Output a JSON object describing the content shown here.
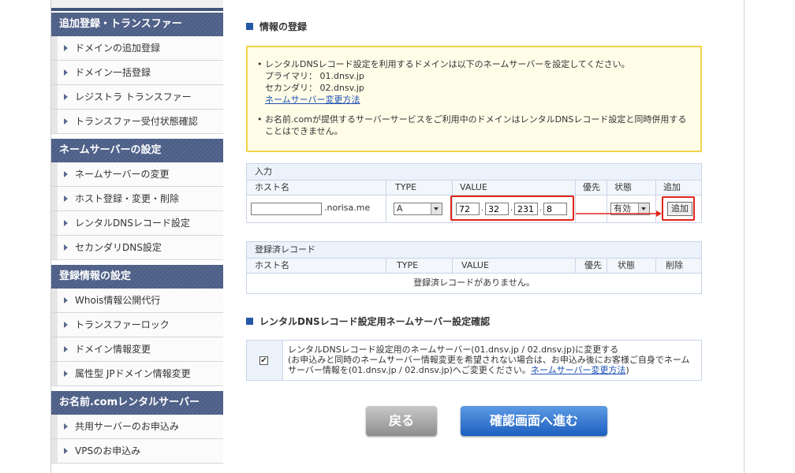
{
  "sidebar": {
    "sections": [
      {
        "title": "追加登録・トランスファー",
        "items": [
          "ドメインの追加登録",
          "ドメイン一括登録",
          "レジストラ トランスファー",
          "トランスファー受付状態確認"
        ]
      },
      {
        "title": "ネームサーバーの設定",
        "items": [
          "ネームサーバーの変更",
          "ホスト登録・変更・削除",
          "レンタルDNSレコード設定",
          "セカンダリDNS設定"
        ]
      },
      {
        "title": "登録情報の設定",
        "items": [
          "Whois情報公開代行",
          "トランスファーロック",
          "ドメイン情報変更",
          "属性型 JPドメイン情報変更"
        ]
      },
      {
        "title": "お名前.comレンタルサーバー",
        "items": [
          "共用サーバーのお申込み",
          "VPSのお申込み"
        ]
      }
    ]
  },
  "main": {
    "heading": "情報の登録",
    "notice": {
      "line1": "レンタルDNSレコード設定を利用するドメインは以下のネームサーバーを設定してください。",
      "primary": "プライマリ：  01.dnsv.jp",
      "secondary": "セカンダリ：  02.dnsv.jp",
      "link": "ネームサーバー変更方法",
      "line2": "お名前.comが提供するサーバーサービスをご利用中のドメインはレンタルDNSレコード設定と同時併用することはできません。",
      "bullet": "•"
    },
    "input_table": {
      "caption": "入力",
      "headers": {
        "host": "ホスト名",
        "type": "TYPE",
        "value": "VALUE",
        "priority": "優先",
        "status": "状態",
        "add": "追加"
      },
      "host_value": "",
      "domain_suffix": ".norisa.me",
      "type_value": "A",
      "ip": [
        "72",
        "32",
        "231",
        "8"
      ],
      "ip_sep": ".",
      "status_value": "有効",
      "add_button": "追加"
    },
    "registered_table": {
      "caption": "登録済レコード",
      "headers": {
        "host": "ホスト名",
        "type": "TYPE",
        "value": "VALUE",
        "priority": "優先",
        "status": "状態",
        "delete": "削除"
      },
      "empty_message": "登録済レコードがありません。"
    },
    "confirm_heading": "レンタルDNSレコード設定用ネームサーバー設定確認",
    "confirm": {
      "checked": true,
      "checkmark": "✔",
      "line1": "レンタルDNSレコード設定用のネームサーバー(01.dnsv.jp / 02.dnsv.jp)に変更する",
      "line2a": "(お申込みと同時のネームサーバー情報変更を希望されない場合は、お申込み後にお客様ご自身でネームサーバー情報を(01.dnsv.jp / 02.dnsv.jp)へご変更ください。",
      "link": "ネームサーバー変更方法",
      "line2b": ")"
    },
    "buttons": {
      "back": "戻る",
      "next": "確認画面へ進む"
    }
  },
  "colors": {
    "accent": "#2557a7",
    "sidebar_header": "#4c5d83",
    "highlight": "#e0241b",
    "notice_border": "#f1d24a"
  }
}
